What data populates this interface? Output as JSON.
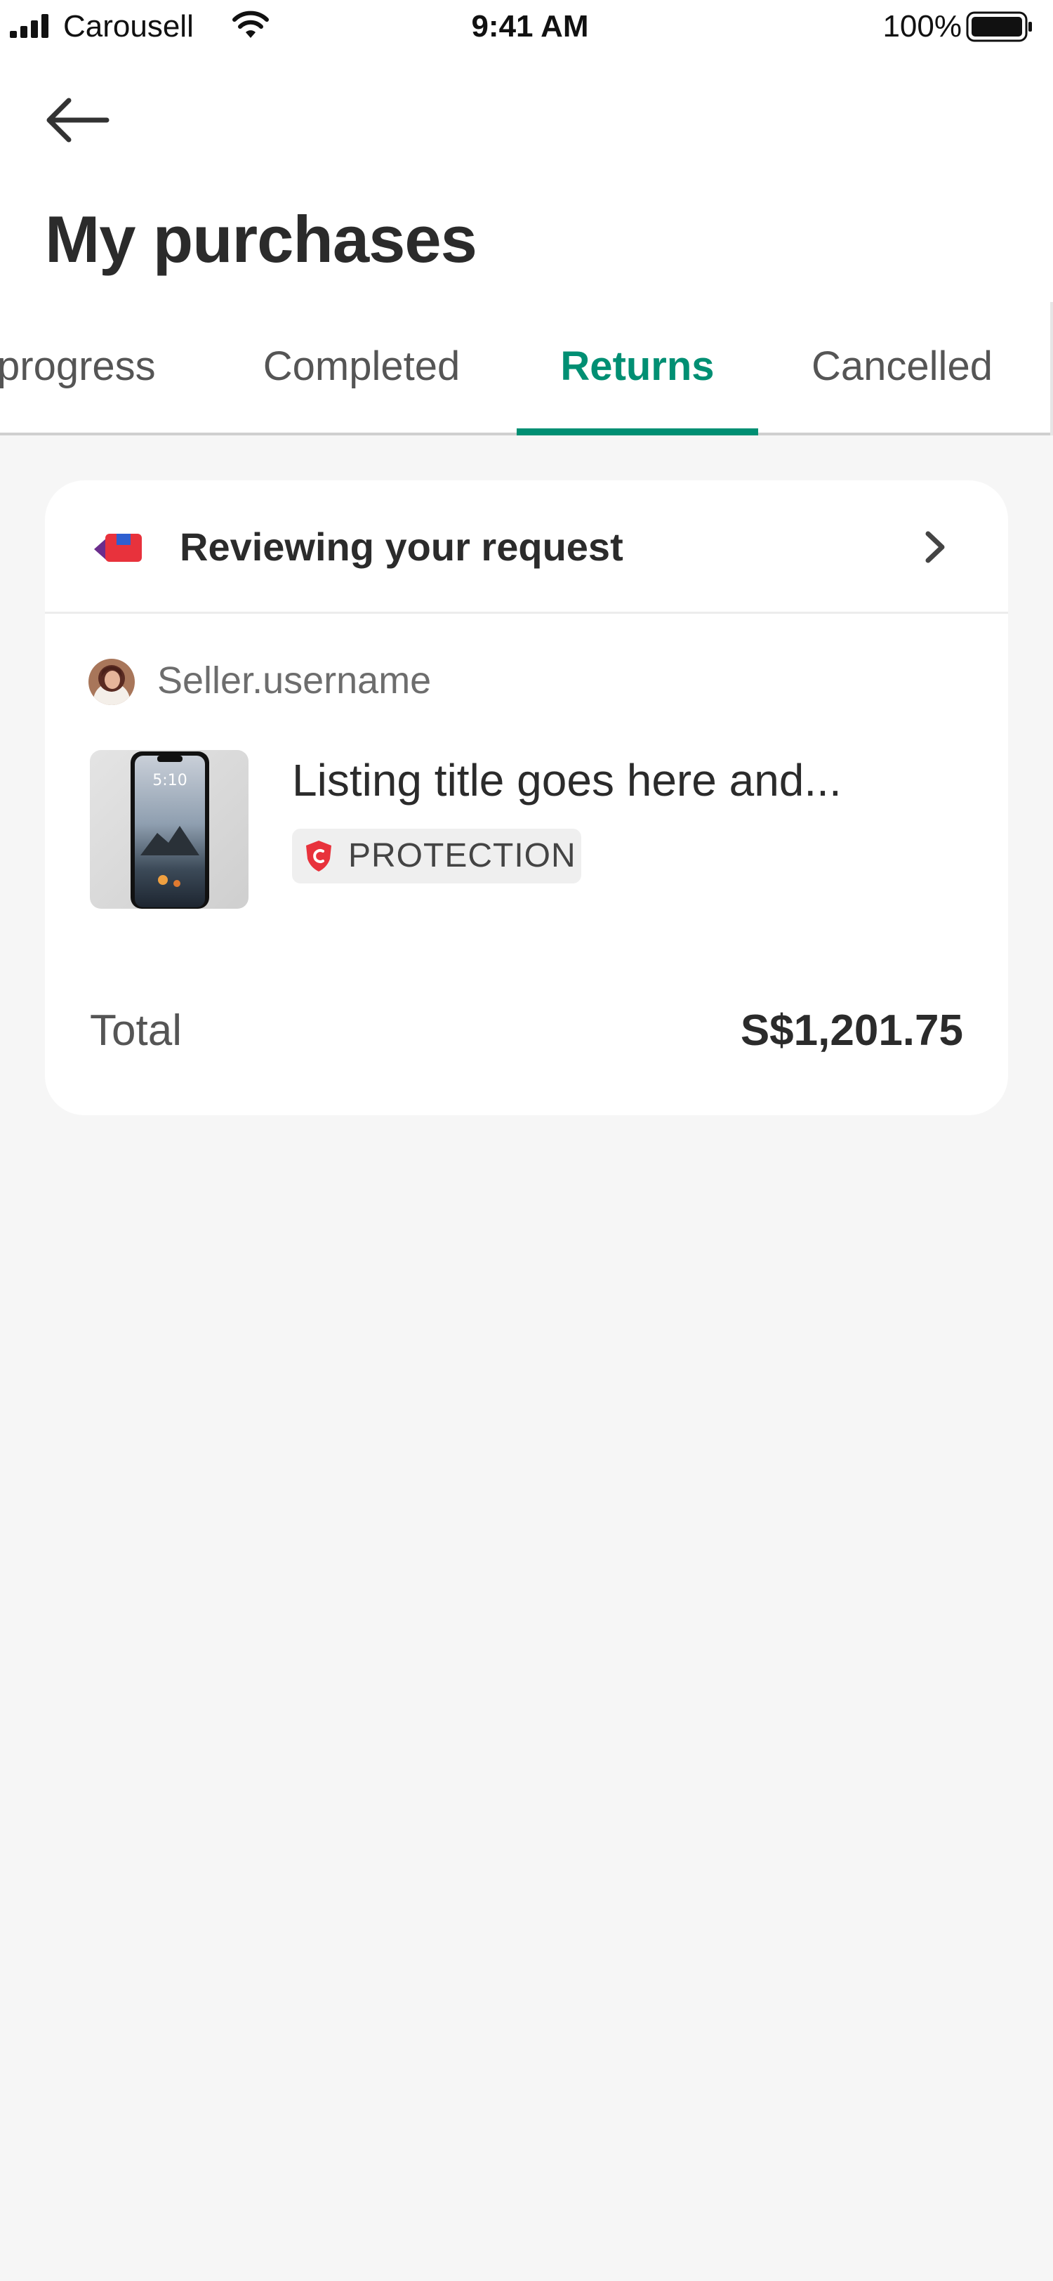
{
  "status_bar": {
    "carrier": "Carousell",
    "time": "9:41 AM",
    "battery": "100%",
    "icons": [
      "signal-icon",
      "wifi-icon",
      "battery-icon"
    ]
  },
  "header": {
    "back_icon": "arrow-left-icon",
    "title": "My purchases"
  },
  "tabs": [
    {
      "label": "progress",
      "active": false
    },
    {
      "label": "Completed",
      "active": false
    },
    {
      "label": "Returns",
      "active": true
    },
    {
      "label": "Cancelled",
      "active": false
    }
  ],
  "order": {
    "status": "Reviewing your request",
    "status_icon": "return-request-icon",
    "chevron_icon": "chevron-right-icon",
    "seller": "Seller.username",
    "listing_title": "Listing title goes here and...",
    "badge": "PROTECTION",
    "badge_icon": "shield-c-icon",
    "total_label": "Total",
    "total_value": "S$1,201.75"
  },
  "colors": {
    "accent": "#008f73",
    "background": "#f6f6f6",
    "card": "#ffffff",
    "protection_red": "#e8323c"
  }
}
